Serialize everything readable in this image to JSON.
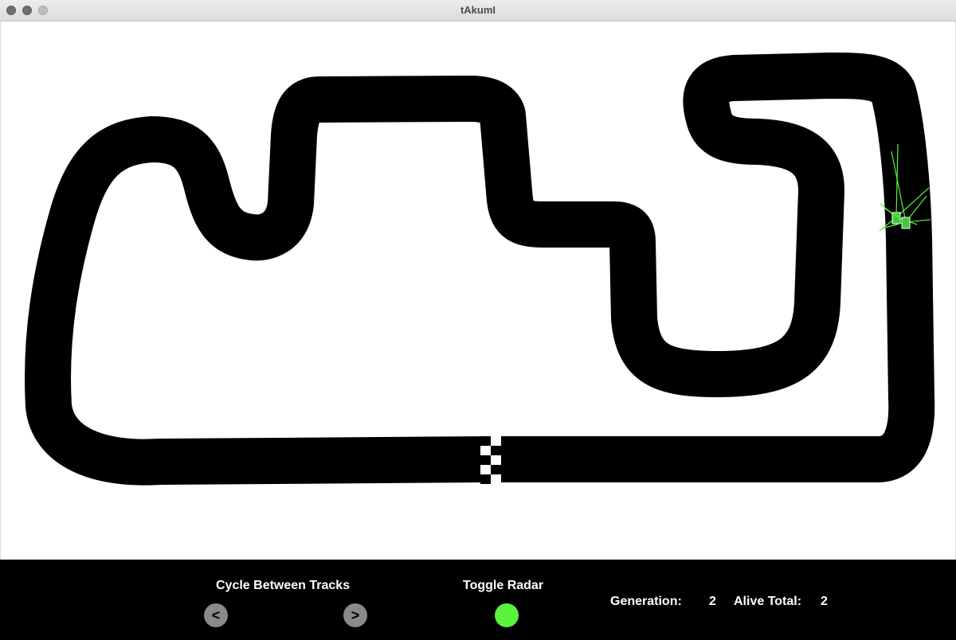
{
  "window": {
    "title": "tAkumI"
  },
  "controls": {
    "cycle_label": "Cycle Between Tracks",
    "prev_label": "<",
    "next_label": ">",
    "radar_label": "Toggle Radar",
    "radar_color": "#5af23c"
  },
  "stats": {
    "generation_label": "Generation:",
    "generation_value": "2",
    "alive_label": "Alive Total:",
    "alive_value": "2"
  },
  "colors": {
    "track": "#000000",
    "background": "#ffffff",
    "radar": "#5af23c",
    "car": "#3fc93a"
  }
}
